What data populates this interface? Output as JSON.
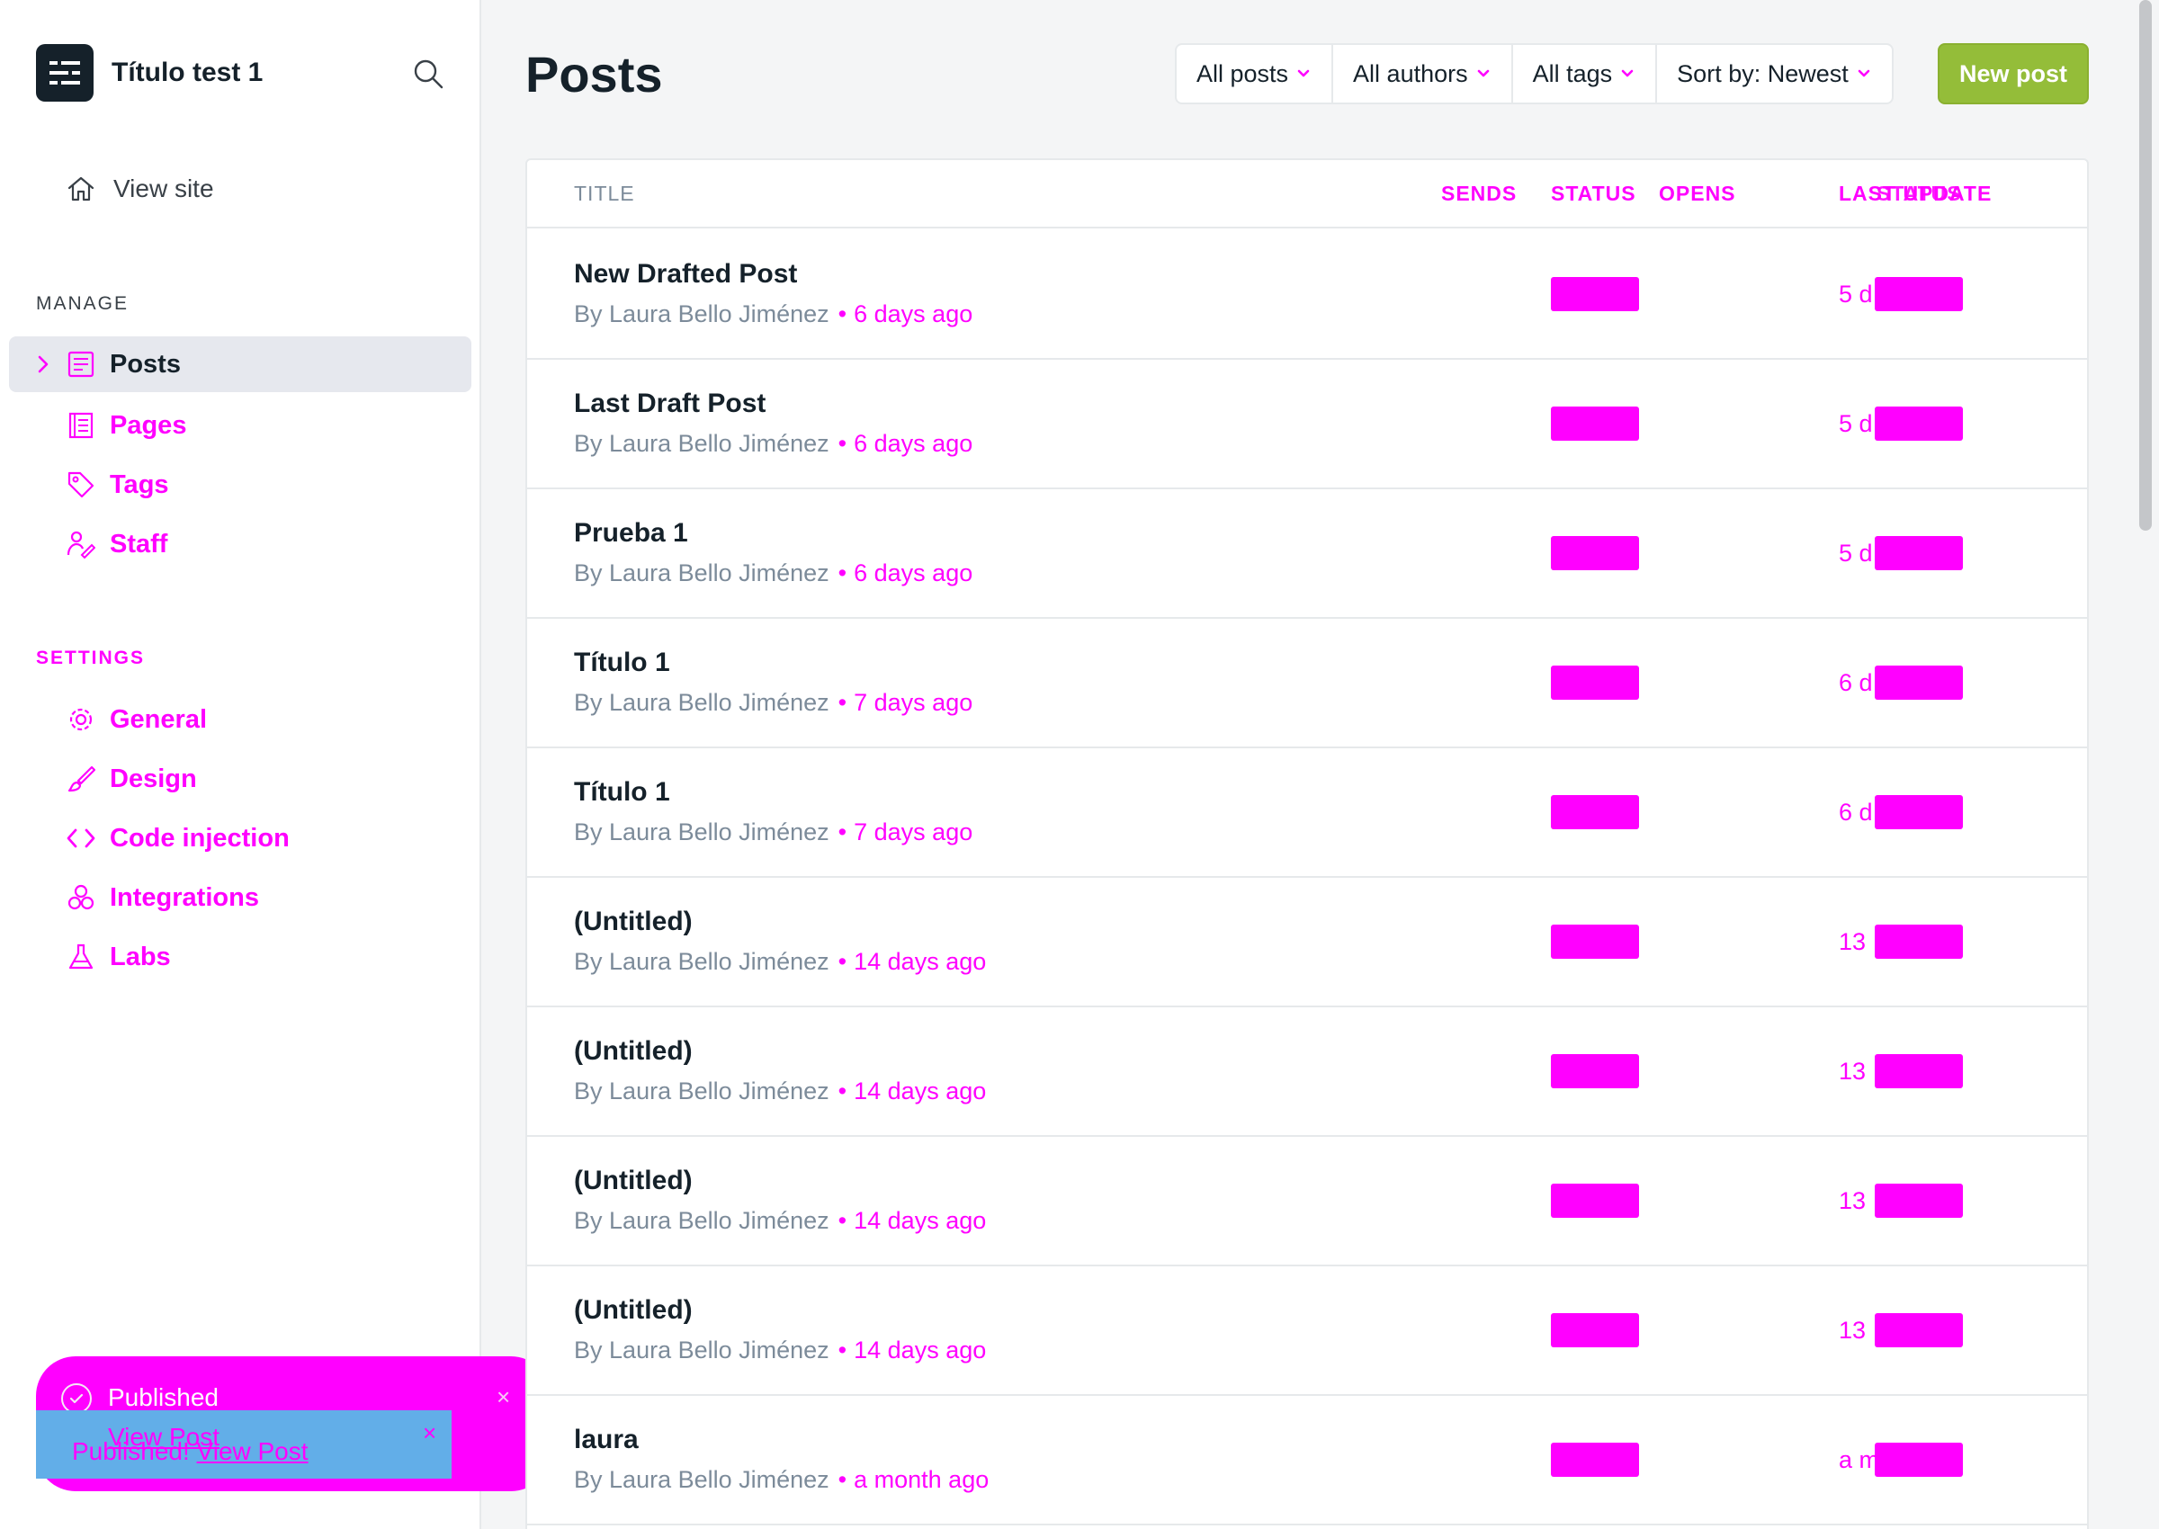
{
  "site": {
    "title": "Título test 1"
  },
  "sidebar": {
    "view_site": "View site",
    "manage_heading": "MANAGE",
    "manage_items": [
      {
        "label": "Posts",
        "icon": "posts-icon"
      },
      {
        "label": "Pages",
        "icon": "pages-icon"
      },
      {
        "label": "Tags",
        "icon": "tag-icon"
      },
      {
        "label": "Staff",
        "icon": "staff-icon"
      }
    ],
    "settings_heading": "SETTINGS",
    "settings_items": [
      {
        "label": "General",
        "icon": "gear-icon"
      },
      {
        "label": "Design",
        "icon": "brush-icon"
      },
      {
        "label": "Code injection",
        "icon": "code-icon"
      },
      {
        "label": "Integrations",
        "icon": "integrations-icon"
      },
      {
        "label": "Labs",
        "icon": "flask-icon"
      }
    ]
  },
  "header": {
    "title": "Posts",
    "filters": [
      "All posts",
      "All authors",
      "All tags",
      "Sort by: Newest"
    ],
    "new_post": "New post"
  },
  "table": {
    "columns": {
      "title": "TITLE",
      "sends": "SENDS",
      "status": "STATUS",
      "opens": "OPENS",
      "last_update": "LAST UPDATE",
      "status2": "STATUS"
    },
    "rows": [
      {
        "title": "New Drafted Post",
        "by": "By",
        "author": "Laura Bello Jiménez",
        "date": "6 days ago",
        "updated": "5 d"
      },
      {
        "title": "Last Draft Post",
        "by": "By",
        "author": "Laura Bello Jiménez",
        "date": "6 days ago",
        "updated": "5 d"
      },
      {
        "title": "Prueba 1",
        "by": "By",
        "author": "Laura Bello Jiménez",
        "date": "6 days ago",
        "updated": "5 d"
      },
      {
        "title": "Título 1",
        "by": "By",
        "author": "Laura Bello Jiménez",
        "date": "7 days ago",
        "updated": "6 d"
      },
      {
        "title": "Título 1",
        "by": "By",
        "author": "Laura Bello Jiménez",
        "date": "7 days ago",
        "updated": "6 d"
      },
      {
        "title": "(Untitled)",
        "by": "By",
        "author": "Laura Bello Jiménez",
        "date": "14 days ago",
        "updated": "13"
      },
      {
        "title": "(Untitled)",
        "by": "By",
        "author": "Laura Bello Jiménez",
        "date": "14 days ago",
        "updated": "13"
      },
      {
        "title": "(Untitled)",
        "by": "By",
        "author": "Laura Bello Jiménez",
        "date": "14 days ago",
        "updated": "13"
      },
      {
        "title": "(Untitled)",
        "by": "By",
        "author": "Laura Bello Jiménez",
        "date": "14 days ago",
        "updated": "13"
      },
      {
        "title": "laura",
        "by": "By",
        "author": "Laura Bello Jiménez",
        "date": "a month ago",
        "updated": "a m"
      }
    ]
  },
  "toasts": {
    "published_title": "Published",
    "ghost_link": "View Post",
    "message": "Published!",
    "message_link": "View Post",
    "close": "×"
  },
  "colors": {
    "accent": "#ff00ff",
    "primary_button": "#94bd39",
    "toast_blue": "#62aee8",
    "sidebar_active": "#e6e8ee",
    "text_dark": "#15212a"
  }
}
